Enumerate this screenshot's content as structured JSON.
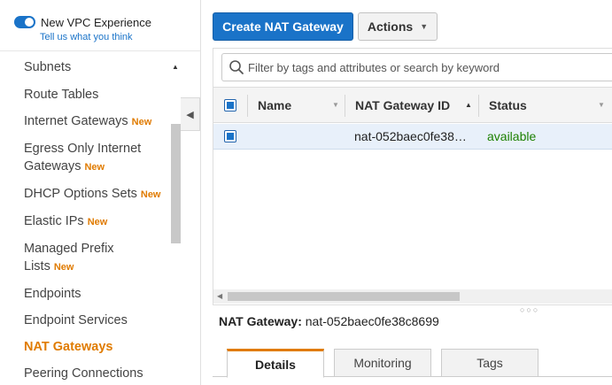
{
  "sidebar": {
    "toggle_title": "New VPC Experience",
    "toggle_link": "Tell us what you think",
    "items": [
      {
        "label": "Subnets",
        "badge": ""
      },
      {
        "label": "Route Tables",
        "badge": ""
      },
      {
        "label": "Internet Gateways",
        "badge": "New"
      },
      {
        "label": "Egress Only Internet",
        "label2": "Gateways",
        "badge": "New"
      },
      {
        "label": "DHCP Options Sets",
        "badge": "New"
      },
      {
        "label": "Elastic IPs",
        "badge": "New"
      },
      {
        "label": "Managed Prefix",
        "label2": "Lists",
        "badge": "New"
      },
      {
        "label": "Endpoints",
        "badge": ""
      },
      {
        "label": "Endpoint Services",
        "badge": ""
      },
      {
        "label": "NAT Gateways",
        "badge": ""
      },
      {
        "label": "Peering Connections",
        "badge": ""
      }
    ]
  },
  "toolbar": {
    "create_label": "Create NAT Gateway",
    "actions_label": "Actions"
  },
  "filter": {
    "placeholder": "Filter by tags and attributes or search by keyword"
  },
  "table": {
    "columns": [
      "Name",
      "NAT Gateway ID",
      "Status"
    ],
    "rows": [
      {
        "name": "",
        "id": "nat-052baec0fe38…",
        "status": "available"
      }
    ]
  },
  "details": {
    "label": "NAT Gateway:",
    "value": "nat-052baec0fe38c8699",
    "tabs": [
      "Details",
      "Monitoring",
      "Tags"
    ]
  },
  "colors": {
    "primary": "#1a73c8",
    "accent": "#e07b00",
    "status_available": "#1d8102"
  }
}
